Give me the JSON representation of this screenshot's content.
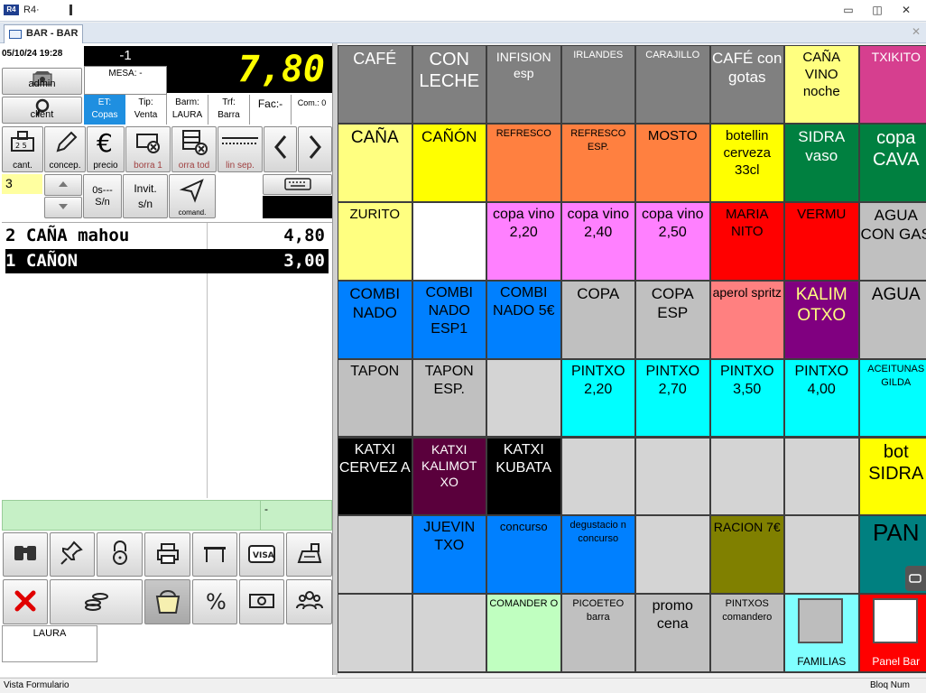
{
  "window": {
    "icon": "R4",
    "title": "R4·",
    "min": "▭",
    "restore": "◫",
    "close": "✕"
  },
  "tab": {
    "label": "BAR - BAR",
    "close": "✕"
  },
  "header": {
    "datetime": "05/10/24 19:28",
    "counter": "-1",
    "mesa": "MESA: -",
    "total": "7,80"
  },
  "admin": {
    "label": "admin"
  },
  "client": {
    "label": "client"
  },
  "info": {
    "et_label": "ET:",
    "et_value": "Copas",
    "tip_label": "Tip:",
    "tip_value": "Venta",
    "barm_label": "Barm:",
    "barm_value": "LAURA",
    "trf_label": "Trf:",
    "trf_value": "Barra",
    "fac": "Fac:-",
    "com": "Com.: 0"
  },
  "actions": {
    "cant": "cant.",
    "concep": "concep.",
    "precio": "precio",
    "borra1": "borra 1",
    "borratod": "orra tod",
    "linsep": "lin sep."
  },
  "qty": {
    "value": "3",
    "os": "0s---",
    "sn": "S/n",
    "invit": "Invit.",
    "invit_sn": "s/n",
    "comand": "comand."
  },
  "order_lines": [
    {
      "text": "2 CAÑA mahou",
      "amount": "4,80",
      "selected": false
    },
    {
      "text": "1 CAÑON",
      "amount": "3,00",
      "selected": true
    }
  ],
  "green_bar": {
    "text": "-"
  },
  "user": {
    "name": "LAURA"
  },
  "status": {
    "left": "Vista Formulario",
    "right": "Bloq Num"
  },
  "icons": [
    "binoculars-icon",
    "pin-icon",
    "lock-icon",
    "printer-icon",
    "table-icon",
    "visa-icon",
    "cash-register-icon",
    "cancel-icon",
    "coins-icon",
    "basket-icon",
    "percent-icon",
    "banknote-icon",
    "users-icon"
  ],
  "products": [
    {
      "label": "CAFÉ",
      "bg": "#808080",
      "fg": "#ffffff",
      "size": 18
    },
    {
      "label": "CON LECHE",
      "bg": "#808080",
      "fg": "#ffffff",
      "size": 20
    },
    {
      "label": "INFISION esp",
      "bg": "#808080",
      "fg": "#ffffff",
      "size": 14
    },
    {
      "label": "IRLANDES",
      "bg": "#808080",
      "fg": "#ffffff",
      "size": 11
    },
    {
      "label": "CARAJILLO",
      "bg": "#808080",
      "fg": "#ffffff",
      "size": 11
    },
    {
      "label": "CAFÉ con gotas",
      "bg": "#808080",
      "fg": "#ffffff",
      "size": 17
    },
    {
      "label": "CAÑA VINO noche",
      "bg": "#ffff80",
      "fg": "#000000",
      "size": 15
    },
    {
      "label": "TXIKITO",
      "bg": "#d63f8f",
      "fg": "#ffffff",
      "size": 14
    },
    {
      "label": "CAÑA",
      "bg": "#ffff80",
      "fg": "#000000",
      "size": 19
    },
    {
      "label": "CAÑÓN",
      "bg": "#ffff00",
      "fg": "#000000",
      "size": 17
    },
    {
      "label": "REFRESCO",
      "bg": "#ff8040",
      "fg": "#000000",
      "size": 11
    },
    {
      "label": "REFRESCO ESP.",
      "bg": "#ff8040",
      "fg": "#000000",
      "size": 11
    },
    {
      "label": "MOSTO",
      "bg": "#ff8040",
      "fg": "#000000",
      "size": 15
    },
    {
      "label": "botellin cerveza 33cl",
      "bg": "#ffff00",
      "fg": "#000000",
      "size": 15
    },
    {
      "label": "SIDRA vaso",
      "bg": "#008040",
      "fg": "#ffffff",
      "size": 17
    },
    {
      "label": "copa CAVA",
      "bg": "#008040",
      "fg": "#ffffff",
      "size": 20
    },
    {
      "label": "ZURITO",
      "bg": "#ffff80",
      "fg": "#000000",
      "size": 15
    },
    {
      "label": "",
      "bg": "#ffffff",
      "fg": "#000000",
      "size": 15
    },
    {
      "label": "copa vino 2,20",
      "bg": "#ff80ff",
      "fg": "#000000",
      "size": 16
    },
    {
      "label": "copa vino 2,40",
      "bg": "#ff80ff",
      "fg": "#000000",
      "size": 16
    },
    {
      "label": "copa vino 2,50",
      "bg": "#ff80ff",
      "fg": "#000000",
      "size": 16
    },
    {
      "label": "MARIA NITO",
      "bg": "#ff0000",
      "fg": "#000000",
      "size": 15
    },
    {
      "label": "VERMU",
      "bg": "#ff0000",
      "fg": "#000000",
      "size": 15
    },
    {
      "label": "AGUA CON GAS",
      "bg": "#c0c0c0",
      "fg": "#000000",
      "size": 17
    },
    {
      "label": "COMBI NADO",
      "bg": "#0080ff",
      "fg": "#000000",
      "size": 17
    },
    {
      "label": "COMBI NADO ESP1",
      "bg": "#0080ff",
      "fg": "#000000",
      "size": 16
    },
    {
      "label": "COMBI NADO 5€",
      "bg": "#0080ff",
      "fg": "#000000",
      "size": 16
    },
    {
      "label": "COPA",
      "bg": "#c0c0c0",
      "fg": "#000000",
      "size": 17
    },
    {
      "label": "COPA ESP",
      "bg": "#c0c0c0",
      "fg": "#000000",
      "size": 17
    },
    {
      "label": "aperol spritz",
      "bg": "#ff8080",
      "fg": "#000000",
      "size": 14
    },
    {
      "label": "KALIM OTXO",
      "bg": "#800080",
      "fg": "#ffff80",
      "size": 19
    },
    {
      "label": "AGUA",
      "bg": "#c0c0c0",
      "fg": "#000000",
      "size": 19
    },
    {
      "label": "TAPON",
      "bg": "#c0c0c0",
      "fg": "#000000",
      "size": 16
    },
    {
      "label": "TAPON ESP.",
      "bg": "#c0c0c0",
      "fg": "#000000",
      "size": 16
    },
    {
      "label": "",
      "bg": "#d4d4d4",
      "fg": "#000000",
      "size": 15
    },
    {
      "label": "PINTXO 2,20",
      "bg": "#00ffff",
      "fg": "#000000",
      "size": 16
    },
    {
      "label": "PINTXO 2,70",
      "bg": "#00ffff",
      "fg": "#000000",
      "size": 16
    },
    {
      "label": "PINTXO 3,50",
      "bg": "#00ffff",
      "fg": "#000000",
      "size": 16
    },
    {
      "label": "PINTXO 4,00",
      "bg": "#00ffff",
      "fg": "#000000",
      "size": 16
    },
    {
      "label": "ACEITUNAS GILDA",
      "bg": "#00ffff",
      "fg": "#000000",
      "size": 11
    },
    {
      "label": "KATXI CERVEZ A",
      "bg": "#000000",
      "fg": "#ffffff",
      "size": 16
    },
    {
      "label": "KATXI KALIMOT XO",
      "bg": "#5a003c",
      "fg": "#ffffff",
      "size": 14
    },
    {
      "label": "KATXI KUBATA",
      "bg": "#000000",
      "fg": "#ffffff",
      "size": 16
    },
    {
      "label": "",
      "bg": "#d4d4d4",
      "fg": "#000000",
      "size": 15
    },
    {
      "label": "",
      "bg": "#d4d4d4",
      "fg": "#000000",
      "size": 15
    },
    {
      "label": "",
      "bg": "#d4d4d4",
      "fg": "#000000",
      "size": 15
    },
    {
      "label": "",
      "bg": "#d4d4d4",
      "fg": "#000000",
      "size": 15
    },
    {
      "label": "bot SIDRA",
      "bg": "#ffff00",
      "fg": "#000000",
      "size": 20
    },
    {
      "label": "",
      "bg": "#d4d4d4",
      "fg": "#000000",
      "size": 15
    },
    {
      "label": "JUEVIN TXO",
      "bg": "#0080ff",
      "fg": "#000000",
      "size": 16
    },
    {
      "label": "concurso",
      "bg": "#0080ff",
      "fg": "#000000",
      "size": 13
    },
    {
      "label": "degustacio n concurso",
      "bg": "#0080ff",
      "fg": "#000000",
      "size": 11
    },
    {
      "label": "",
      "bg": "#d4d4d4",
      "fg": "#000000",
      "size": 15
    },
    {
      "label": "RACION 7€",
      "bg": "#808000",
      "fg": "#000000",
      "size": 14
    },
    {
      "label": "",
      "bg": "#d4d4d4",
      "fg": "#000000",
      "size": 15
    },
    {
      "label": "PAN",
      "bg": "#008080",
      "fg": "#000000",
      "size": 26
    },
    {
      "label": "",
      "bg": "#d4d4d4",
      "fg": "#000000",
      "size": 15
    },
    {
      "label": "",
      "bg": "#d4d4d4",
      "fg": "#000000",
      "size": 15
    },
    {
      "label": "COMANDER O",
      "bg": "#c0ffc0",
      "fg": "#000000",
      "size": 11
    },
    {
      "label": "PICOETEO barra",
      "bg": "#c0c0c0",
      "fg": "#000000",
      "size": 11
    },
    {
      "label": "promo cena",
      "bg": "#c0c0c0",
      "fg": "#000000",
      "size": 16
    },
    {
      "label": "PINTXOS comandero",
      "bg": "#c0c0c0",
      "fg": "#000000",
      "size": 11
    },
    {
      "label": "FAMILIAS",
      "bg": "#80ffff",
      "fg": "#000000",
      "size": 12
    },
    {
      "label": "Panel Bar",
      "bg": "#ff0000",
      "fg": "#ffffff",
      "size": 12
    }
  ]
}
